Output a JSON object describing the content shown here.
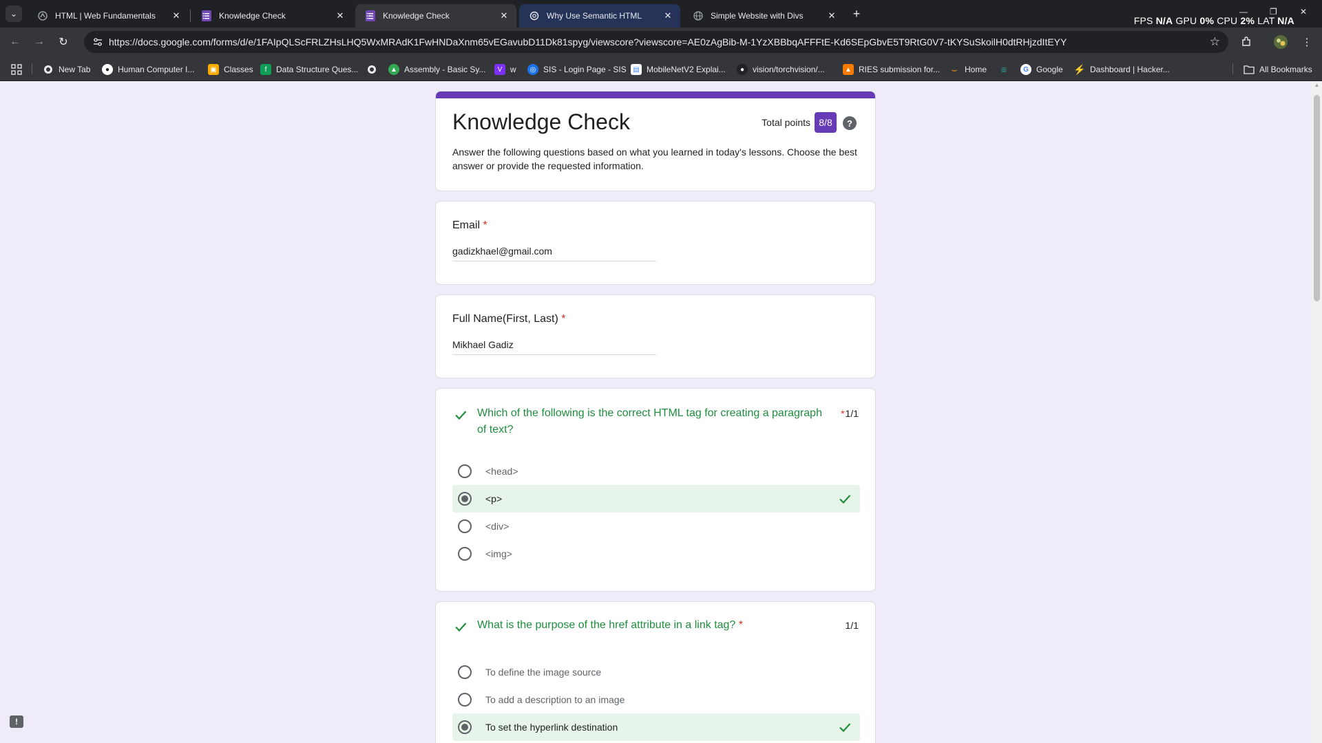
{
  "browser": {
    "tabs": [
      {
        "title": "HTML | Web Fundamentals",
        "icon": "web-fundamentals-icon",
        "state": "inactive"
      },
      {
        "title": "Knowledge Check",
        "icon": "google-forms-icon",
        "state": "inactive"
      },
      {
        "title": "Knowledge Check",
        "icon": "google-forms-icon",
        "state": "active"
      },
      {
        "title": "Why Use Semantic HTML",
        "icon": "openai-icon",
        "state": "highlighted"
      },
      {
        "title": "Simple Website with Divs",
        "icon": "globe-icon",
        "state": "inactive"
      }
    ],
    "tab_close": "✕",
    "new_tab": "+",
    "perf": {
      "fps_label": "FPS",
      "fps_value": "N/A",
      "gpu_label": "GPU",
      "gpu_value": "0%",
      "cpu_label": "CPU",
      "cpu_value": "2%",
      "lat_label": "LAT",
      "lat_value": "N/A"
    },
    "url": "https://docs.google.com/forms/d/e/1FAIpQLScFRLZHsLHQ5WxMRAdK1FwHNDaXnm65vEGavubD11Dk81spyg/viewscore?viewscore=AE0zAgBib-M-1YzXBBbqAFFFtE-Kd6SEpGbvE5T9RtG0V7-tKYSuSkoilH0dtRHjzdItEYY",
    "bookmarks": [
      {
        "label": "New Tab",
        "icon": "globe-icon",
        "color": "#5f6368"
      },
      {
        "label": "Human Computer I...",
        "icon": "github-icon",
        "color": "#202124"
      },
      {
        "label": "Classes",
        "icon": "classroom-icon",
        "color": "#1e8e3e"
      },
      {
        "label": "Data Structure Ques...",
        "icon": "sheet-icon",
        "color": "#0f9d58"
      },
      {
        "label": "",
        "icon": "globe-icon",
        "color": "#5f6368"
      },
      {
        "label": "Assembly - Basic Sy...",
        "icon": "book-icon",
        "color": "#34a853"
      },
      {
        "label": "w",
        "icon": "v-icon",
        "color": "#7b2ff7"
      },
      {
        "label": "SIS - Login Page - SIS",
        "icon": "sis-icon",
        "color": "#1a73e8"
      },
      {
        "label": "MobileNetV2 Explai...",
        "icon": "doc-icon",
        "color": "#4285f4"
      },
      {
        "label": "vision/torchvision/...",
        "icon": "github-icon",
        "color": "#202124"
      },
      {
        "label": "RIES submission for...",
        "icon": "ries-icon",
        "color": "#f57c00"
      },
      {
        "label": "Home",
        "icon": "amazon-icon",
        "color": "#ff9900"
      },
      {
        "label": "",
        "icon": "dash-icon",
        "color": "#26a69a"
      },
      {
        "label": "Google",
        "icon": "google-icon",
        "color": "#ffffff"
      },
      {
        "label": "Dashboard | Hacker...",
        "icon": "bolt-icon",
        "color": "#2ec866"
      }
    ],
    "all_bookmarks": "All Bookmarks"
  },
  "form": {
    "title": "Knowledge Check",
    "total_points_label": "Total points",
    "total_points_value": "8/8",
    "help": "?",
    "description": "Answer the following questions based on what you learned in today's lessons. Choose the best answer or provide the requested information.",
    "accent_color": "#673ab7",
    "email": {
      "label": "Email",
      "required": "*",
      "value": "gadizkhael@gmail.com"
    },
    "full_name": {
      "label": "Full Name(First, Last)",
      "required": "*",
      "value": "Mikhael Gadiz"
    },
    "questions": [
      {
        "text": "Which of the following is the correct HTML tag for creating a paragraph of text?",
        "required": "*",
        "score": "1/1",
        "options": [
          {
            "label": "<head>",
            "selected": false,
            "correct": false
          },
          {
            "label": "<p>",
            "selected": true,
            "correct": true
          },
          {
            "label": "<div>",
            "selected": false,
            "correct": false
          },
          {
            "label": "<img>",
            "selected": false,
            "correct": false
          }
        ]
      },
      {
        "text": "What is the purpose of the href attribute in a link tag?",
        "required": "*",
        "score": "1/1",
        "options": [
          {
            "label": "To define the image source",
            "selected": false,
            "correct": false
          },
          {
            "label": "To add a description to an image",
            "selected": false,
            "correct": false
          },
          {
            "label": "To set the hyperlink destination",
            "selected": true,
            "correct": true
          }
        ]
      }
    ]
  }
}
